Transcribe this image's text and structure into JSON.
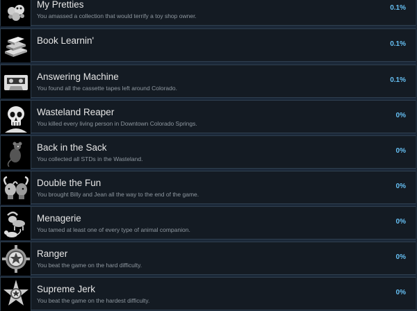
{
  "achievements": [
    {
      "title": "My Pretties",
      "description": "You amassed a collection that would terrify a toy shop owner.",
      "percent": "0.1%",
      "icon": "toy-collection-icon"
    },
    {
      "title": "Book Learnin'",
      "description": "",
      "percent": "0.1%",
      "icon": "books-icon"
    },
    {
      "title": "Answering Machine",
      "description": "You found all the cassette tapes left around Colorado.",
      "percent": "0.1%",
      "icon": "cassette-tape-icon"
    },
    {
      "title": "Wasteland Reaper",
      "description": "You killed every living person in Downtown Colorado Springs.",
      "percent": "0%",
      "icon": "skull-icon"
    },
    {
      "title": "Back in the Sack",
      "description": "You collected all STDs in the Wasteland.",
      "percent": "0%",
      "icon": "rodent-icon"
    },
    {
      "title": "Double the Fun",
      "description": "You brought Billy and Jean all the way to the end of the game.",
      "percent": "0%",
      "icon": "two-goat-heads-icon"
    },
    {
      "title": "Menagerie",
      "description": "You tamed at least one of every type of animal companion.",
      "percent": "0%",
      "icon": "animals-icon"
    },
    {
      "title": "Ranger",
      "description": "You beat the game on the hard difficulty.",
      "percent": "0%",
      "icon": "ranger-badge-icon"
    },
    {
      "title": "Supreme Jerk",
      "description": "You beat the game on the hardest difficulty.",
      "percent": "0%",
      "icon": "star-badge-icon"
    }
  ]
}
